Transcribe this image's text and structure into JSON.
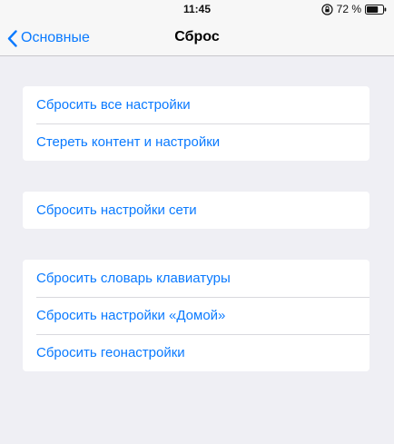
{
  "status_bar": {
    "time": "11:45",
    "battery_percent": "72 %",
    "battery_level": 0.72,
    "orientation_lock_icon": "orientation-lock-icon"
  },
  "nav": {
    "back_label": "Основные",
    "title": "Сброс",
    "back_icon": "chevron-left-icon"
  },
  "colors": {
    "accent": "#0a7aff",
    "background": "#efeff4",
    "cell_background": "#ffffff"
  },
  "groups": [
    {
      "items": [
        {
          "label": "Сбросить все настройки"
        },
        {
          "label": "Стереть контент и настройки"
        }
      ]
    },
    {
      "items": [
        {
          "label": "Сбросить настройки сети"
        }
      ]
    },
    {
      "items": [
        {
          "label": "Сбросить словарь клавиатуры"
        },
        {
          "label": "Сбросить настройки «Домой»"
        },
        {
          "label": "Сбросить геонастройки"
        }
      ]
    }
  ]
}
